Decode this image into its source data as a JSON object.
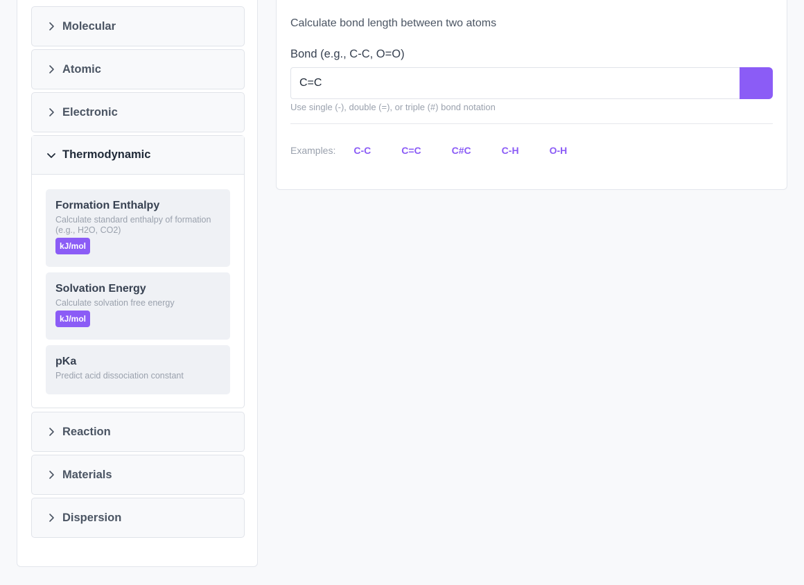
{
  "sidebar": {
    "categories": [
      {
        "label": "Molecular"
      },
      {
        "label": "Atomic"
      },
      {
        "label": "Electronic"
      },
      {
        "label": "Thermodynamic"
      },
      {
        "label": "Reaction"
      },
      {
        "label": "Materials"
      },
      {
        "label": "Dispersion"
      }
    ],
    "thermo_items": [
      {
        "title": "Formation Enthalpy",
        "desc": "Calculate standard enthalpy of formation (e.g., H2O, CO2)",
        "unit": "kJ/mol"
      },
      {
        "title": "Solvation Energy",
        "desc": "Calculate solvation free energy",
        "unit": "kJ/mol"
      },
      {
        "title": "pKa",
        "desc": "Predict acid dissociation constant"
      }
    ]
  },
  "panel": {
    "description": "Calculate bond length between two atoms",
    "input_label": "Bond (e.g., C-C, O=O)",
    "input_value": "C=C",
    "hint": "Use single (-), double (=), or triple (#) bond notation",
    "examples_label": "Examples:",
    "examples": [
      "C-C",
      "C=C",
      "C#C",
      "C-H",
      "O-H"
    ]
  },
  "colors": {
    "accent": "#8b5cf6"
  }
}
